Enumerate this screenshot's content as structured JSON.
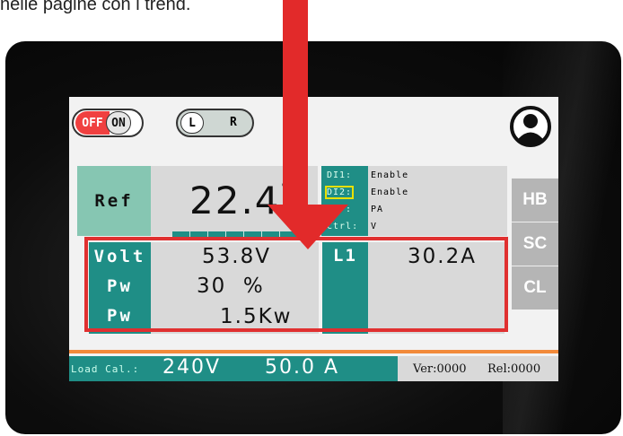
{
  "caption": "nelle pagine con i trend.",
  "hmi": {
    "power_toggle": {
      "off_label": "OFF",
      "on_label": "ON"
    },
    "side_toggle": {
      "left_label": "L",
      "right_label": "R"
    },
    "user_icon": "user-avatar-icon",
    "ref": {
      "label": "Ref",
      "value": "22.4",
      "unit": "°"
    },
    "digital_inputs": [
      {
        "key": "DI1:",
        "value": "Enable"
      },
      {
        "key": "DI2:",
        "value": "Enable"
      },
      {
        "key": "Dir:",
        "value": "PA"
      },
      {
        "key": "Ctrl:",
        "value": "V"
      }
    ],
    "side_buttons": [
      "HB",
      "SC",
      "CL"
    ],
    "readings": [
      {
        "label": "Volt",
        "value": "53.8V"
      },
      {
        "label": "Pw",
        "value": "30  %"
      },
      {
        "label": "Pw",
        "value": "1.5Kw"
      }
    ],
    "l1": {
      "label": "L1",
      "value": "30.2A"
    },
    "footer": {
      "load_label": "Load Cal.:",
      "voltage": "240V",
      "current": "50.0 A",
      "version": "Ver:0000",
      "release": "Rel:0000"
    }
  },
  "colors": {
    "teal": "#1f8e86",
    "accent_red": "#e22a2a",
    "orange": "#f28a3a",
    "panel_grey": "#d9d9d9"
  }
}
